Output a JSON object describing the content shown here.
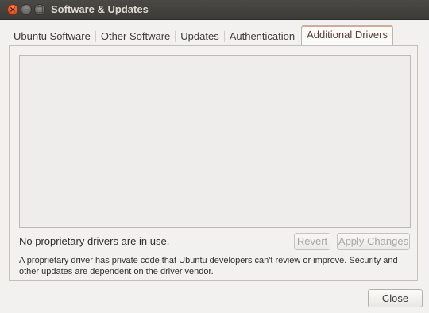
{
  "window": {
    "title": "Software & Updates",
    "close_glyph": "×",
    "minimize_glyph": "–",
    "maximize_glyph": "□"
  },
  "tabs": [
    {
      "label": "Ubuntu Software",
      "active": false
    },
    {
      "label": "Other Software",
      "active": false
    },
    {
      "label": "Updates",
      "active": false
    },
    {
      "label": "Authentication",
      "active": false
    },
    {
      "label": "Additional Drivers",
      "active": true
    }
  ],
  "drivers": {
    "items": [],
    "status": "No proprietary drivers are in use.",
    "revert_label": "Revert",
    "apply_label": "Apply Changes",
    "info": "A proprietary driver has private code that Ubuntu developers can't review or improve. Security and other updates are dependent on the driver vendor."
  },
  "footer": {
    "close_label": "Close"
  },
  "colors": {
    "titlebar": "#3c3b37",
    "close_button": "#e55b29",
    "active_tab_accent": "#e4a489",
    "background": "#f2f1f0"
  }
}
